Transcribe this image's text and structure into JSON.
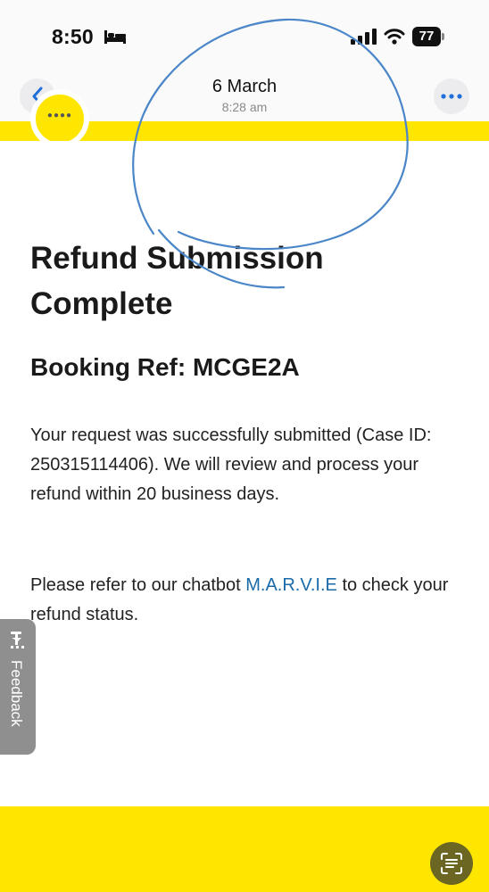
{
  "status_bar": {
    "time": "8:50",
    "battery": "77",
    "icons": [
      "bed-icon",
      "cellular-signal-icon",
      "wifi-icon",
      "battery-icon"
    ]
  },
  "header": {
    "date": "6 March",
    "time": "8:28 am",
    "back_icon": "chevron-left-icon",
    "more_icon": "ellipsis-icon"
  },
  "content": {
    "title": "Refund Submission Complete",
    "booking_ref": "Booking Ref: MCGE2A",
    "paragraph1": "Your request was successfully submitted (Case ID: 250315114406). We will review and process your refund within 20 business days.",
    "paragraph2_before": "Please refer to our chatbot ",
    "paragraph2_link": "M.A.R.V.I.E",
    "paragraph2_after": " to check your refund status."
  },
  "feedback": {
    "label": "Feedback"
  },
  "colors": {
    "brand_yellow": "#ffe600",
    "link_blue": "#1a6aa8",
    "annotation_blue": "#4a86c8"
  }
}
